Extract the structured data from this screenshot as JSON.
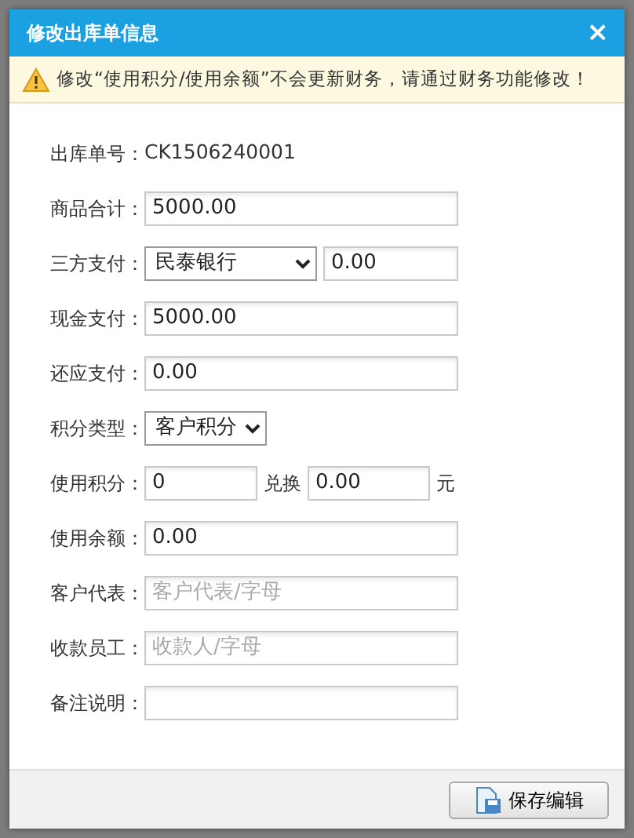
{
  "dialog": {
    "title": "修改出库单信息",
    "close": "×"
  },
  "warning": "修改“使用积分/使用余额”不会更新财务，请通过财务功能修改！",
  "order": {
    "label": "出库单号：",
    "value": "CK1506240001"
  },
  "fields": [
    {
      "kind": "text",
      "label": "商品合计：",
      "value": "5000.00"
    },
    {
      "kind": "select_text",
      "label": "三方支付：",
      "selected_option": "民泰银行",
      "value": "0.00"
    },
    {
      "kind": "text",
      "label": "现金支付：",
      "value": "5000.00"
    },
    {
      "kind": "text",
      "label": "还应支付：",
      "value": "0.00"
    },
    {
      "kind": "select",
      "label": "积分类型：",
      "selected_option": "客户积分"
    },
    {
      "kind": "points",
      "label": "使用积分：",
      "value": "0",
      "middle": "兑换",
      "value2": "0.00",
      "unit": "元"
    },
    {
      "kind": "text",
      "label": "使用余额：",
      "value": "0.00"
    },
    {
      "kind": "text",
      "label": "客户代表：",
      "placeholder": "客户代表/字母"
    },
    {
      "kind": "text",
      "label": "收款员工：",
      "placeholder": "收款人/字母"
    },
    {
      "kind": "text",
      "label": "备注说明："
    }
  ],
  "save_button": "保存编辑"
}
